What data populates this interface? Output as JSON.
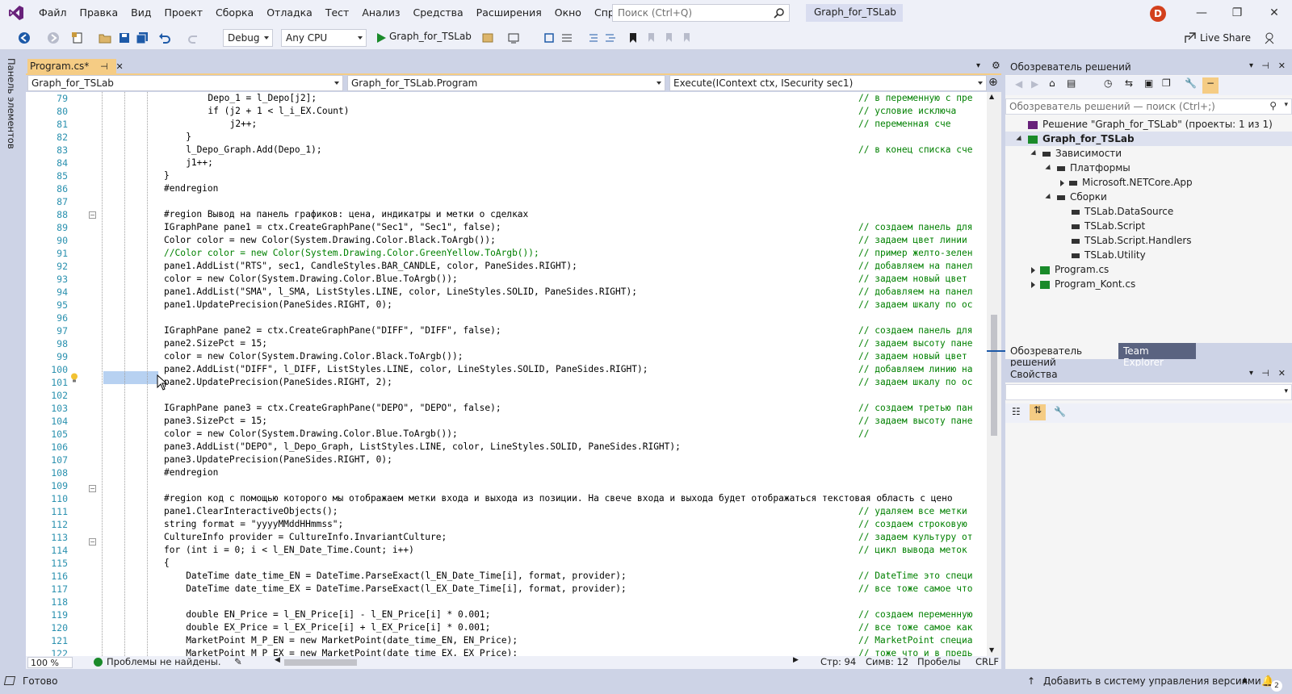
{
  "menu": [
    "Файл",
    "Правка",
    "Вид",
    "Проект",
    "Сборка",
    "Отладка",
    "Тест",
    "Анализ",
    "Средства",
    "Расширения",
    "Окно",
    "Справка"
  ],
  "search": {
    "placeholder": "Поиск (Ctrl+Q)"
  },
  "project_title": "Graph_for_TSLab",
  "avatar_letter": "D",
  "toolbar": {
    "config": "Debug",
    "platform": "Any CPU",
    "start": "Graph_for_TSLab",
    "live_share": "Live Share"
  },
  "toolbox_label": "Панель элементов",
  "doc_tab": {
    "label": "Program.cs*",
    "pin": "⊣"
  },
  "nav": {
    "project": "Graph_for_TSLab",
    "class": "Graph_for_TSLab.Program",
    "member": "Execute(IContext ctx, ISecurity sec1)"
  },
  "editor": {
    "lines": [
      {
        "n": "79",
        "i": 4,
        "c": "Depo_1 = l_Depo[j2];",
        "m": "// в переменную с пре"
      },
      {
        "n": "80",
        "i": 4,
        "c": "if (j2 + 1 < l_i_EX.Count)",
        "m": "// условие исключа"
      },
      {
        "n": "81",
        "i": 5,
        "c": "j2++;",
        "m": "// переменная сче"
      },
      {
        "n": "82",
        "i": 3,
        "c": "}",
        "m": ""
      },
      {
        "n": "83",
        "i": 3,
        "c": "l_Depo_Graph.Add(Depo_1);",
        "m": "// в конец списка сче"
      },
      {
        "n": "84",
        "i": 3,
        "c": "j1++;",
        "m": ""
      },
      {
        "n": "85",
        "i": 2,
        "c": "}",
        "m": ""
      },
      {
        "n": "86",
        "i": 2,
        "c": "#endregion",
        "m": ""
      },
      {
        "n": "87",
        "i": 0,
        "c": "",
        "m": ""
      },
      {
        "n": "88",
        "i": 2,
        "c": "#region Вывод на панель графиков: цена, индикатры и метки о сделках",
        "m": ""
      },
      {
        "n": "89",
        "i": 2,
        "c": "IGraphPane pane1 = ctx.CreateGraphPane(\"Sec1\", \"Sec1\", false);",
        "m": "// создаем панель для"
      },
      {
        "n": "90",
        "i": 2,
        "c": "Color color = new Color(System.Drawing.Color.Black.ToArgb());",
        "m": "// задаем цвет линии"
      },
      {
        "n": "91",
        "i": 2,
        "c": "//Color color = new Color(System.Drawing.Color.GreenYellow.ToArgb());",
        "m": "// пример желто-зелен"
      },
      {
        "n": "92",
        "i": 2,
        "c": "pane1.AddList(\"RTS\", sec1, CandleStyles.BAR_CANDLE, color, PaneSides.RIGHT);",
        "m": "// добавляем на панел"
      },
      {
        "n": "93",
        "i": 2,
        "c": "color = new Color(System.Drawing.Color.Blue.ToArgb());",
        "m": "// задаем новый цвет"
      },
      {
        "n": "94",
        "i": 2,
        "c": "pane1.AddList(\"SMA\", l_SMA, ListStyles.LINE, color, LineStyles.SOLID, PaneSides.RIGHT);",
        "m": "// добавляем на панел"
      },
      {
        "n": "95",
        "i": 2,
        "c": "pane1.UpdatePrecision(PaneSides.RIGHT, 0);",
        "m": "// задаем шкалу по ос"
      },
      {
        "n": "96",
        "i": 0,
        "c": "",
        "m": ""
      },
      {
        "n": "97",
        "i": 2,
        "c": "IGraphPane pane2 = ctx.CreateGraphPane(\"DIFF\", \"DIFF\", false);",
        "m": "// создаем панель для"
      },
      {
        "n": "98",
        "i": 2,
        "c": "pane2.SizePct = 15;",
        "m": "// задаем высоту пане"
      },
      {
        "n": "99",
        "i": 2,
        "c": "color = new Color(System.Drawing.Color.Black.ToArgb());",
        "m": "// задаем новый цвет"
      },
      {
        "n": "100",
        "i": 2,
        "c": "pane2.AddList(\"DIFF\", l_DIFF, ListStyles.LINE, color, LineStyles.SOLID, PaneSides.RIGHT);",
        "m": "// добавляем линию на"
      },
      {
        "n": "101",
        "i": 2,
        "c": "pane2.UpdatePrecision(PaneSides.RIGHT, 2);",
        "m": "// задаем шкалу по ос"
      },
      {
        "n": "102",
        "i": 0,
        "c": "",
        "m": ""
      },
      {
        "n": "103",
        "i": 2,
        "c": "IGraphPane pane3 = ctx.CreateGraphPane(\"DEPO\", \"DEPO\", false);",
        "m": "// создаем третью пан"
      },
      {
        "n": "104",
        "i": 2,
        "c": "pane3.SizePct = 15;",
        "m": "// задаем высоту пане"
      },
      {
        "n": "105",
        "i": 2,
        "c": "color = new Color(System.Drawing.Color.Blue.ToArgb());",
        "m": "//"
      },
      {
        "n": "106",
        "i": 2,
        "c": "pane3.AddList(\"DEPO\", l_Depo_Graph, ListStyles.LINE, color, LineStyles.SOLID, PaneSides.RIGHT);",
        "m": ""
      },
      {
        "n": "107",
        "i": 2,
        "c": "pane3.UpdatePrecision(PaneSides.RIGHT, 0);",
        "m": ""
      },
      {
        "n": "108",
        "i": 2,
        "c": "#endregion",
        "m": ""
      },
      {
        "n": "109",
        "i": 0,
        "c": "",
        "m": ""
      },
      {
        "n": "110",
        "i": 2,
        "c": "#region код с помощью которого мы отображаем метки входа и выхода из позиции. На свече входа и выхода будет отображаться текстовая область с цено",
        "m": ""
      },
      {
        "n": "111",
        "i": 2,
        "c": "pane1.ClearInteractiveObjects();",
        "m": "// удаляем все метки"
      },
      {
        "n": "112",
        "i": 2,
        "c": "string format = \"yyyyMMddHHmmss\";",
        "m": "// создаем строковую"
      },
      {
        "n": "113",
        "i": 2,
        "c": "CultureInfo provider = CultureInfo.InvariantCulture;",
        "m": "// задаем культуру от"
      },
      {
        "n": "114",
        "i": 2,
        "c": "for (int i = 0; i < l_EN_Date_Time.Count; i++)",
        "m": "// цикл вывода меток"
      },
      {
        "n": "115",
        "i": 2,
        "c": "{",
        "m": ""
      },
      {
        "n": "116",
        "i": 3,
        "c": "DateTime date_time_EN = DateTime.ParseExact(l_EN_Date_Time[i], format, provider);",
        "m": "// DateTime это специ"
      },
      {
        "n": "117",
        "i": 3,
        "c": "DateTime date_time_EX = DateTime.ParseExact(l_EX_Date_Time[i], format, provider);",
        "m": "// все тоже самое что"
      },
      {
        "n": "118",
        "i": 0,
        "c": "",
        "m": ""
      },
      {
        "n": "119",
        "i": 3,
        "c": "double EN_Price = l_EN_Price[i] - l_EN_Price[i] * 0.001;",
        "m": "// создаем переменную"
      },
      {
        "n": "120",
        "i": 3,
        "c": "double EX_Price = l_EX_Price[i] + l_EX_Price[i] * 0.001;",
        "m": "// все тоже самое как"
      },
      {
        "n": "121",
        "i": 3,
        "c": "MarketPoint M_P_EN = new MarketPoint(date_time_EN, EN_Price);",
        "m": "// MarketPoint специа"
      },
      {
        "n": "122",
        "i": 3,
        "c": "MarketPoint M_P_EX = new MarketPoint(date_time_EX, EX_Price);",
        "m": "// тоже что и в предь"
      }
    ]
  },
  "status_line": {
    "zoom": "100 %",
    "problems": "Проблемы не найдены.",
    "line": "Стр: 94",
    "col": "Симв: 12",
    "spaces": "Пробелы",
    "eol": "CRLF"
  },
  "statusbar": {
    "ready": "Готово",
    "vcs": "Добавить в систему управления версиями",
    "notif": "2"
  },
  "solution_explorer": {
    "title": "Обозреватель решений",
    "search_placeholder": "Обозреватель решений — поиск (Ctrl+;)",
    "items": [
      {
        "label": "Решение \"Graph_for_TSLab\" (проекты: 1 из 1)",
        "level": 0,
        "exp": "",
        "icon": "solution"
      },
      {
        "label": "Graph_for_TSLab",
        "level": 0,
        "exp": "down",
        "icon": "csproj",
        "bold": true
      },
      {
        "label": "Зависимости",
        "level": 1,
        "exp": "down",
        "icon": "deps"
      },
      {
        "label": "Платформы",
        "level": 2,
        "exp": "down",
        "icon": "deps"
      },
      {
        "label": "Microsoft.NETCore.App",
        "level": 3,
        "exp": "right",
        "icon": "deps"
      },
      {
        "label": "Сборки",
        "level": 2,
        "exp": "down",
        "icon": "ref"
      },
      {
        "label": "TSLab.DataSource",
        "level": 3,
        "exp": "",
        "icon": "ref"
      },
      {
        "label": "TSLab.Script",
        "level": 3,
        "exp": "",
        "icon": "ref"
      },
      {
        "label": "TSLab.Script.Handlers",
        "level": 3,
        "exp": "",
        "icon": "ref"
      },
      {
        "label": "TSLab.Utility",
        "level": 3,
        "exp": "",
        "icon": "ref"
      },
      {
        "label": "Program.cs",
        "level": 1,
        "exp": "right",
        "icon": "cs"
      },
      {
        "label": "Program_Kont.cs",
        "level": 1,
        "exp": "right",
        "icon": "cs"
      }
    ],
    "tabs": [
      "Обозреватель решений",
      "Team Explorer"
    ]
  },
  "properties": {
    "title": "Свойства"
  },
  "colors": {
    "accent": "#68217a",
    "tab_active": "#f5cc84",
    "bg": "#cdd3e6",
    "comment": "#008000",
    "line_number": "#2b91af"
  }
}
